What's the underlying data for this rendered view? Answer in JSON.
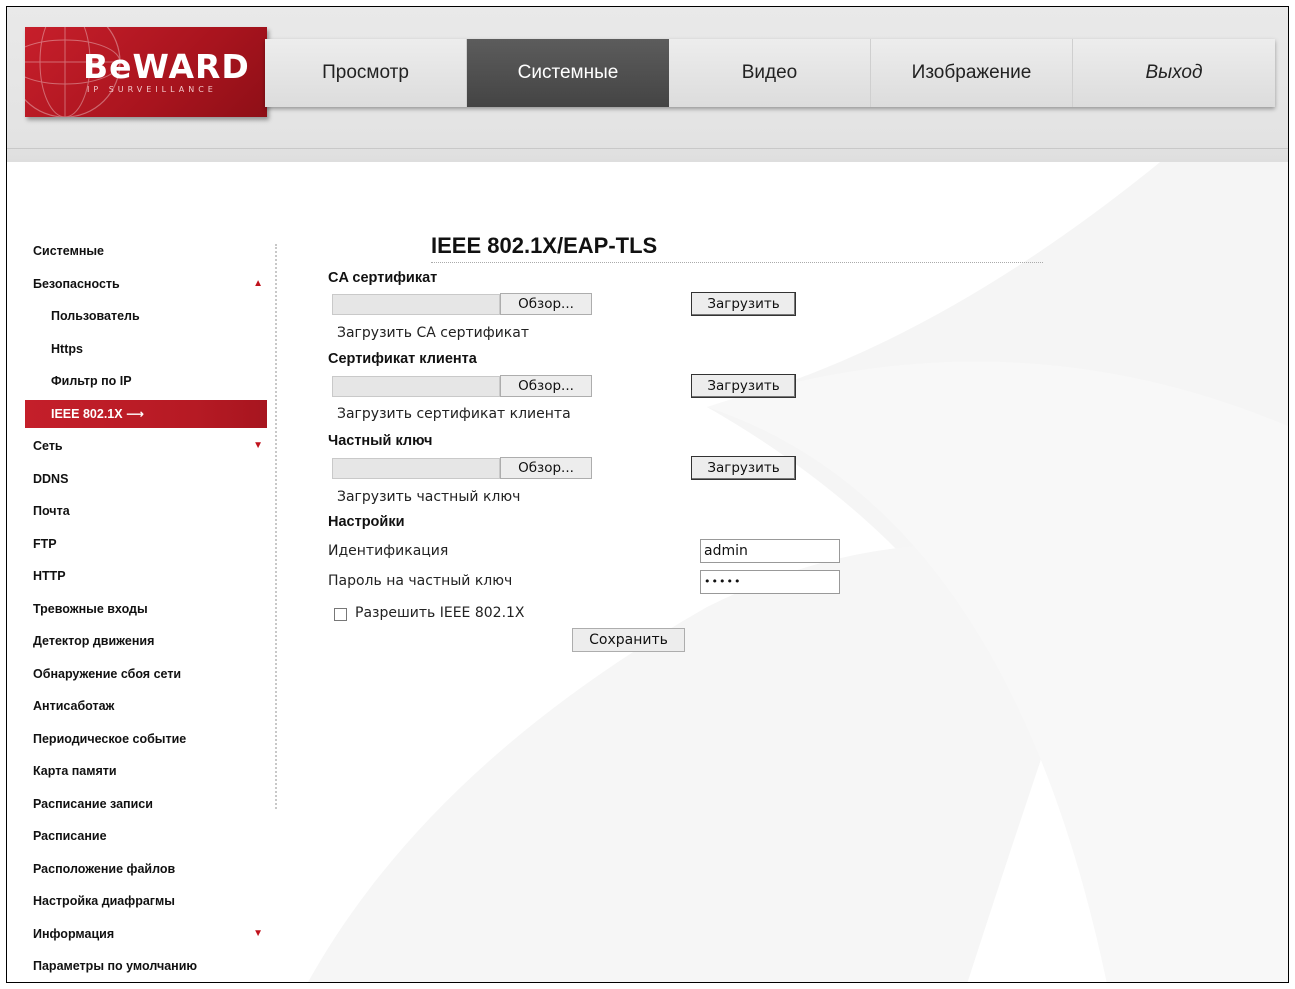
{
  "brand": {
    "logo_text": "BeWARD",
    "logo_sub": "IP SURVEILLANCE"
  },
  "topnav": {
    "items": [
      {
        "label": "Просмотр",
        "active": false
      },
      {
        "label": "Системные",
        "active": true
      },
      {
        "label": "Видео",
        "active": false
      },
      {
        "label": "Изображение",
        "active": false
      },
      {
        "label": "Выход",
        "active": false
      }
    ]
  },
  "sidebar": {
    "items": [
      {
        "label": "Системные"
      },
      {
        "label": "Безопасность",
        "arrow": "▲"
      },
      {
        "label": "Пользователь"
      },
      {
        "label": "Https"
      },
      {
        "label": "Фильтр по IP"
      },
      {
        "label": "IEEE 802.1X ⟶"
      },
      {
        "label": "Сеть",
        "arrow": "▼"
      },
      {
        "label": "DDNS"
      },
      {
        "label": "Почта"
      },
      {
        "label": "FTP"
      },
      {
        "label": "HTTP"
      },
      {
        "label": "Тревожные входы"
      },
      {
        "label": "Детектор движения"
      },
      {
        "label": "Обнаружение сбоя сети"
      },
      {
        "label": "Антисаботаж"
      },
      {
        "label": "Периодическое событие"
      },
      {
        "label": "Карта памяти"
      },
      {
        "label": "Расписание записи"
      },
      {
        "label": "Расписание"
      },
      {
        "label": "Расположение файлов"
      },
      {
        "label": "Настройка диафрагмы"
      },
      {
        "label": "Информация",
        "arrow": "▼"
      },
      {
        "label": "Параметры по умолчанию"
      }
    ]
  },
  "main": {
    "title": "IEEE 802.1X/EAP-TLS",
    "ca": {
      "title": "CA сертификат",
      "browse": "Обзор...",
      "upload": "Загрузить",
      "hint": "Загрузить CA сертификат"
    },
    "client": {
      "title": "Сертификат клиента",
      "browse": "Обзор...",
      "upload": "Загрузить",
      "hint": "Загрузить сертификат клиента"
    },
    "private_key": {
      "title": "Частный ключ",
      "browse": "Обзор...",
      "upload": "Загрузить",
      "hint": "Загрузить частный ключ"
    },
    "settings": {
      "title": "Настройки",
      "identity_label": "Идентификация",
      "identity_value": "admin",
      "password_label": "Пароль на частный ключ",
      "password_value": "•••••",
      "enable_label": "Разрешить IEEE 802.1X",
      "enable_checked": false
    },
    "save_label": "Сохранить"
  },
  "colors": {
    "accent": "#c41f2a",
    "nav_active": "#505050"
  }
}
